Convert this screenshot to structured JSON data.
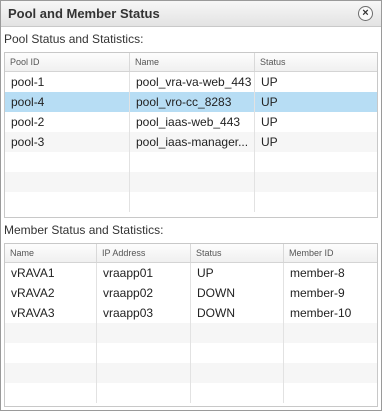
{
  "dialog": {
    "title": "Pool and Member Status",
    "close_glyph": "×",
    "close_icon": "close-icon"
  },
  "pool_section": {
    "label": "Pool Status and Statistics:",
    "columns": [
      "Pool ID",
      "Name",
      "Status"
    ],
    "rows": [
      {
        "id": "pool-1",
        "name": "pool_vra-va-web_443",
        "status": "UP"
      },
      {
        "id": "pool-4",
        "name": "pool_vro-cc_8283",
        "status": "UP",
        "selected": true
      },
      {
        "id": "pool-2",
        "name": "pool_iaas-web_443",
        "status": "UP"
      },
      {
        "id": "pool-3",
        "name": "pool_iaas-manager...",
        "status": "UP"
      }
    ]
  },
  "member_section": {
    "label": "Member Status and Statistics:",
    "columns": [
      "Name",
      "IP Address",
      "Status",
      "Member ID"
    ],
    "rows": [
      {
        "name": "vRAVA1",
        "ip": "vraapp01",
        "status": "UP",
        "member_id": "member-8"
      },
      {
        "name": "vRAVA2",
        "ip": "vraapp02",
        "status": "DOWN",
        "member_id": "member-9"
      },
      {
        "name": "vRAVA3",
        "ip": "vraapp03",
        "status": "DOWN",
        "member_id": "member-10"
      }
    ]
  },
  "colors": {
    "selected_row": "#b7ddf4",
    "alt_row": "#f6f6f6",
    "border": "#c8c8c8"
  }
}
